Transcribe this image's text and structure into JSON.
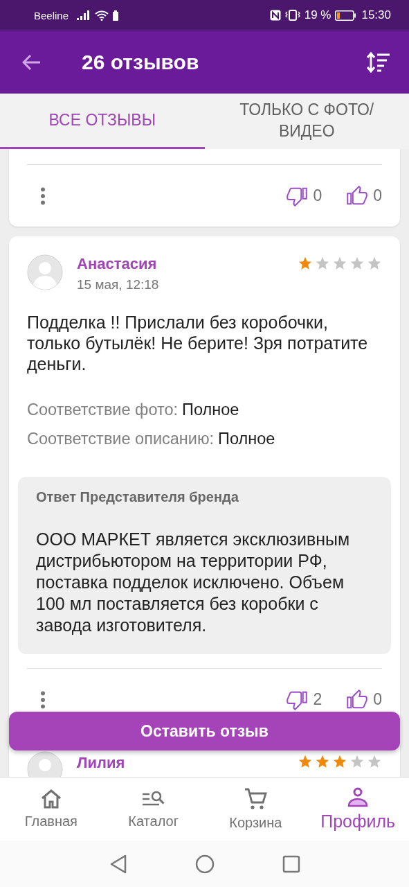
{
  "status_bar": {
    "carrier": "Beeline",
    "battery": "19 %",
    "time": "15:30"
  },
  "app_bar": {
    "title": "26 отзывов"
  },
  "tabs": [
    {
      "label": "ВСЕ ОТЗЫВЫ",
      "selected": true
    },
    {
      "label": "ТОЛЬКО С ФОТО/ ВИДЕО",
      "selected": false
    }
  ],
  "previous_review": {
    "dislikes": "0",
    "likes": "0"
  },
  "review": {
    "author": "Анастасия",
    "date": "15 мая, 12:18",
    "stars": 1,
    "text": "Подделка !! Прислали без коробочки, только бутылёк! Не берите! Зря потратите деньги.",
    "matches": [
      {
        "label": "Соответствие фото:",
        "value": "Полное"
      },
      {
        "label": "Соответствие описанию:",
        "value": "Полное"
      }
    ],
    "reply": {
      "title": "Ответ Представителя бренда",
      "text": "ООО МАРКЕТ является эксклюзивным дистрибьютором на территории РФ, поставка подделок исключено. Объем 100 мл поставляется без коробки с завода изготовителя."
    },
    "dislikes": "2",
    "likes": "0"
  },
  "next_review": {
    "author": "Лилия",
    "stars": 3
  },
  "action_button": "Оставить отзыв",
  "bottom_nav": [
    {
      "label": "Главная",
      "selected": false
    },
    {
      "label": "Каталог",
      "selected": false
    },
    {
      "label": "Корзина",
      "selected": false
    },
    {
      "label": "Профиль",
      "selected": true
    }
  ]
}
